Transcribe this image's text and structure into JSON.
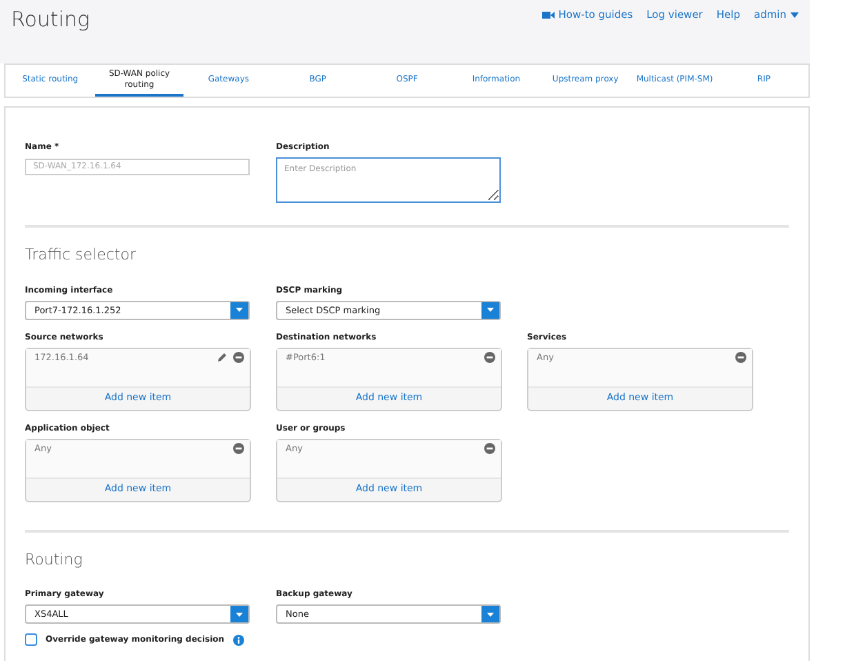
{
  "page_title": "Routing",
  "top_links": [
    {
      "label": "How-to guides",
      "kind": "video"
    },
    {
      "label": "Log viewer",
      "kind": "link"
    },
    {
      "label": "Help",
      "kind": "link"
    },
    {
      "label": "admin",
      "kind": "menu"
    }
  ],
  "tabs": [
    {
      "label": "Static routing",
      "selected": false
    },
    {
      "label": "SD-WAN policy routing",
      "selected": true
    },
    {
      "label": "Gateways",
      "selected": false
    },
    {
      "label": "BGP",
      "selected": false
    },
    {
      "label": "OSPF",
      "selected": false
    },
    {
      "label": "Information",
      "selected": false
    },
    {
      "label": "Upstream proxy",
      "selected": false
    },
    {
      "label": "Multicast (PIM-SM)",
      "selected": false
    },
    {
      "label": "RIP",
      "selected": false
    }
  ],
  "name_field": {
    "label": "Name *",
    "value": "SD-WAN_172.16.1.64",
    "disabled": true
  },
  "description_field": {
    "label": "Description",
    "placeholder": "Enter Description"
  },
  "traffic_selector": {
    "heading": "Traffic selector",
    "selects": [
      {
        "label": "Incoming interface",
        "value": "Port7-172.16.1.252"
      },
      {
        "label": "DSCP marking",
        "value": "Select DSCP marking"
      }
    ],
    "item_lists": [
      {
        "label": "Source networks",
        "item": "172.16.1.64",
        "editable": true,
        "add_label": "Add new item"
      },
      {
        "label": "Destination networks",
        "item": "#Port6:1",
        "editable": false,
        "add_label": "Add new item"
      },
      {
        "label": "Services",
        "item": "Any",
        "editable": false,
        "add_label": "Add new item"
      },
      {
        "label": "Application object",
        "item": "Any",
        "editable": false,
        "add_label": "Add new item"
      },
      {
        "label": "User or groups",
        "item": "Any",
        "editable": false,
        "add_label": "Add new item"
      }
    ]
  },
  "routing": {
    "heading": "Routing",
    "selects": [
      {
        "label": "Primary gateway",
        "value": "XS4ALL"
      },
      {
        "label": "Backup gateway",
        "value": "None"
      }
    ],
    "checkbox": {
      "label": "Override gateway monitoring decision",
      "checked": false
    }
  }
}
